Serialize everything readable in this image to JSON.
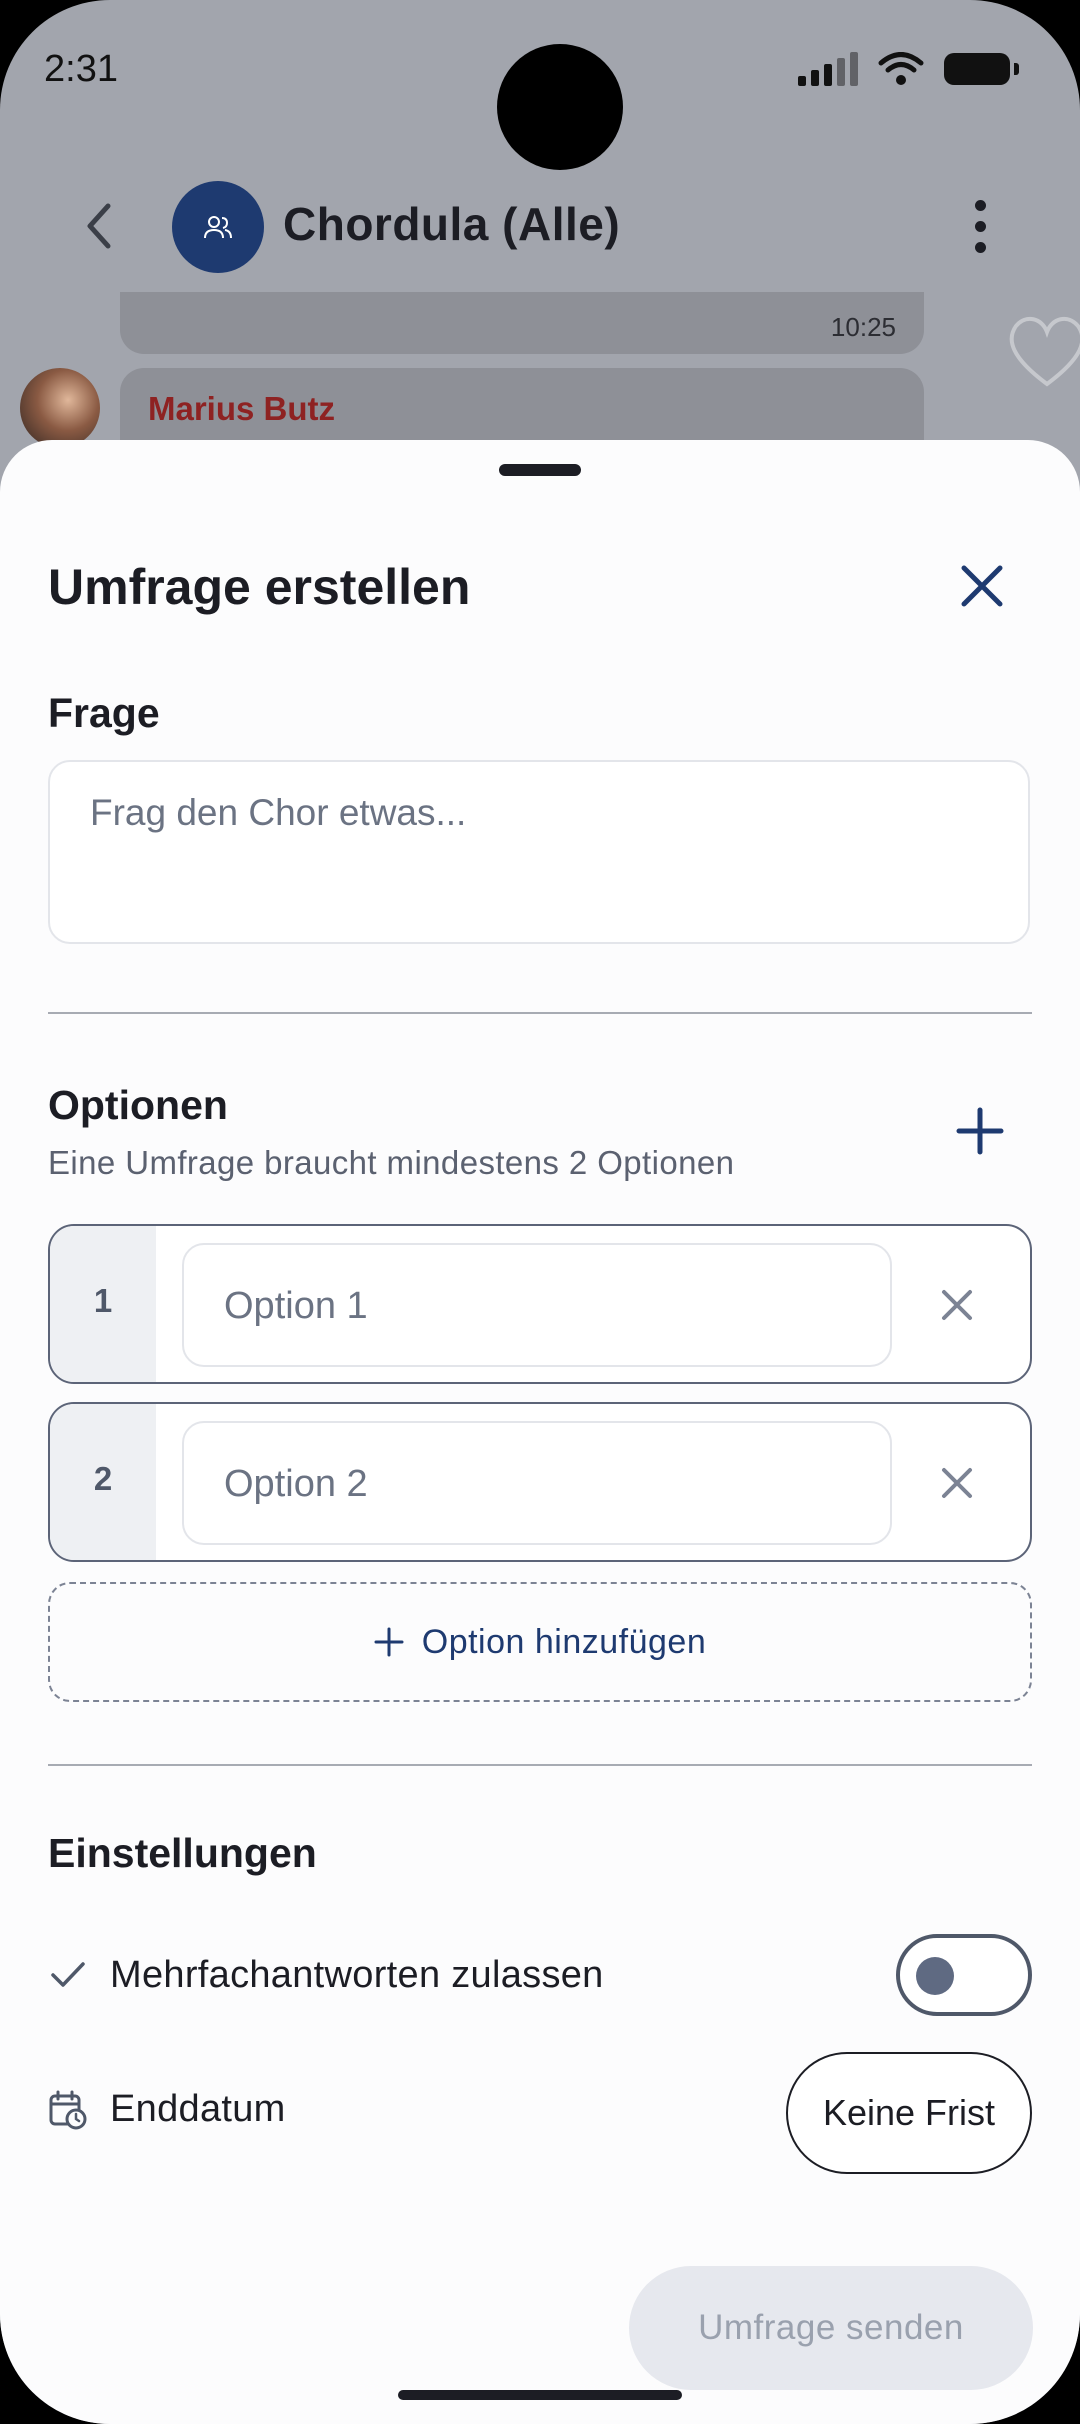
{
  "status_bar": {
    "time": "2:31"
  },
  "chat_header": {
    "title": "Chordula (Alle)"
  },
  "chat_behind": {
    "prev_message_time": "10:25",
    "next_sender": "Marius Butz"
  },
  "sheet": {
    "title": "Umfrage erstellen",
    "question": {
      "label": "Frage",
      "placeholder": "Frag den Chor etwas..."
    },
    "options": {
      "label": "Optionen",
      "hint": "Eine Umfrage braucht mindestens 2 Optionen",
      "items": [
        {
          "number": "1",
          "placeholder": "Option 1"
        },
        {
          "number": "2",
          "placeholder": "Option 2"
        }
      ],
      "add_label": "Option hinzufügen"
    },
    "settings": {
      "label": "Einstellungen",
      "multiple_answers": {
        "label": "Mehrfachantworten zulassen",
        "enabled": false
      },
      "end_date": {
        "label": "Enddatum",
        "value": "Keine Frist"
      }
    },
    "submit_label": "Umfrage senden"
  },
  "icons": {
    "back": "chevron-left-icon",
    "group": "group-icon",
    "menu": "kebab-menu-icon",
    "close": "close-icon",
    "add": "plus-icon",
    "remove": "close-icon",
    "check": "check-icon",
    "calendar": "calendar-clock-icon"
  },
  "colors": {
    "accent": "#1e3a70",
    "text": "#1c1d24",
    "muted": "#6b7383",
    "sender": "#8e2222"
  }
}
